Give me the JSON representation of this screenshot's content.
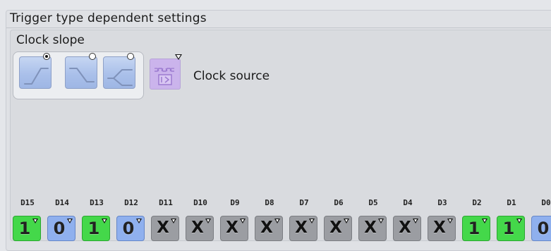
{
  "header": {
    "title": "Trigger type dependent settings"
  },
  "clock_slope": {
    "label": "Clock slope",
    "options": [
      {
        "name": "rising-edge",
        "selected": true
      },
      {
        "name": "falling-edge",
        "selected": false
      },
      {
        "name": "either-edge",
        "selected": false
      }
    ]
  },
  "clock_source": {
    "label": "Clock source",
    "icon": "data-bus-icon"
  },
  "channels": [
    {
      "label": "D15",
      "value": "1"
    },
    {
      "label": "D14",
      "value": "0"
    },
    {
      "label": "D13",
      "value": "1"
    },
    {
      "label": "D12",
      "value": "0"
    },
    {
      "label": "D11",
      "value": "X"
    },
    {
      "label": "D10",
      "value": "X"
    },
    {
      "label": "D9",
      "value": "X"
    },
    {
      "label": "D8",
      "value": "X"
    },
    {
      "label": "D7",
      "value": "X"
    },
    {
      "label": "D6",
      "value": "X"
    },
    {
      "label": "D5",
      "value": "X"
    },
    {
      "label": "D4",
      "value": "X"
    },
    {
      "label": "D3",
      "value": "X"
    },
    {
      "label": "D2",
      "value": "1"
    },
    {
      "label": "D1",
      "value": "1"
    },
    {
      "label": "D0",
      "value": "0"
    }
  ],
  "colors": {
    "value_1": "#44d84a",
    "value_0": "#8fb0ee",
    "value_x": "#9b9da2",
    "slope_button": "#aac0ea",
    "clock_source_button": "#cbb4ec"
  }
}
